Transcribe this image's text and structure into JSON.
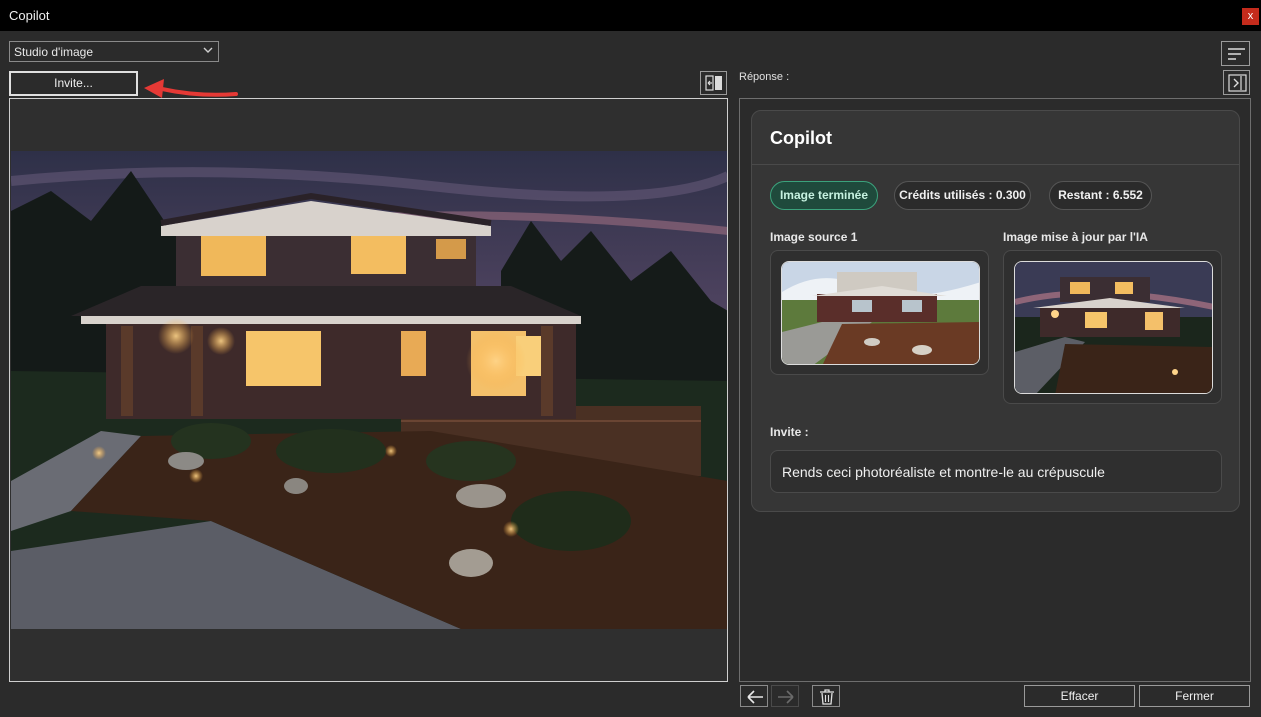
{
  "window": {
    "title": "Copilot",
    "close_label": "x"
  },
  "toolbar": {
    "mode_select": "Studio d'image",
    "invite_button": "Invite..."
  },
  "response": {
    "label": "Réponse :",
    "card_title": "Copilot",
    "status": "Image terminée",
    "credits_used": "Crédits utilisés : 0.300",
    "remaining": "Restant : 6.552",
    "source_label": "Image source 1",
    "updated_label": "Image mise à jour par l'IA",
    "prompt_label": "Invite :",
    "prompt_text": "Rends ceci photoréaliste et montre-le au crépuscule"
  },
  "footer": {
    "clear_button": "Effacer",
    "close_button": "Fermer"
  },
  "colors": {
    "title_bar": "#000000",
    "close_button": "#c42b1c",
    "annotation_arrow": "#e53935",
    "status_pill": "#1f4a3c",
    "status_pill_border": "#3ba27c"
  },
  "icons": {
    "close": "close-icon",
    "dropdown": "chevron-down-icon",
    "swap": "swap-panel-icon",
    "menu": "menu-lines-icon",
    "collapse": "collapse-right-icon",
    "back": "arrow-left-icon",
    "forward": "arrow-right-icon",
    "delete": "trash-icon"
  }
}
